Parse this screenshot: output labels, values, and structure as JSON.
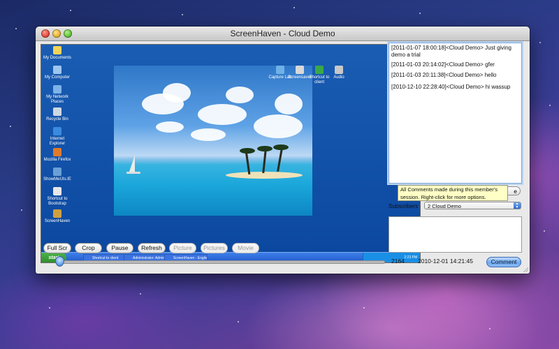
{
  "window": {
    "title": "ScreenHaven - Cloud Demo"
  },
  "remote_desktop": {
    "icons": [
      "My Documents",
      "My Computer",
      "My Network Places",
      "Recycle Bin",
      "Internet Explorer",
      "Mozilla Firefox",
      "ShowMeUIs.IE",
      "Shortcut to Bootstrap",
      "ScreenHaven"
    ],
    "top_icons": [
      "Capture Lab",
      "Screensaver",
      "Shortcut to client",
      "Audio"
    ],
    "start_label": "start",
    "taskbar_items": [
      "Shortcut to client",
      "Administrator: Admin...",
      "ScreenHaven - English"
    ],
    "tray_time": "2:23 PM"
  },
  "toolbar": {
    "full_scr": "Full Scr",
    "crop": "Crop",
    "pause": "Pause",
    "refresh": "Refresh",
    "picture": "Picture",
    "pictures": "Pictures",
    "movie": "Movie"
  },
  "playback": {
    "frame": "2164",
    "timestamp": "2010-12-01 14:21:45",
    "position": 0.0
  },
  "comments": [
    {
      "line1": "[2011-01-07 18:00:18]<Cloud Demo> Just giving",
      "line2": "demo a trial"
    },
    {
      "line1": "[2011-01-03 20:14:02]<Cloud Demo> gfer",
      "line2": ""
    },
    {
      "line1": "[2011-01-03 20:11:38]<Cloud Demo> hello",
      "line2": ""
    },
    {
      "line1": "[2010-12-10 22:28:40]<Cloud Demo> hi wassup",
      "line2": ""
    }
  ],
  "tooltip": {
    "line1": "All Comments made during this member's",
    "line2": "session. Right-click for more options."
  },
  "hidden_button_label": "e",
  "subscribers": {
    "label": "Subscribers",
    "selected": "2 Cloud Demo"
  },
  "compose": {
    "value": ""
  },
  "comment_button": "Comment",
  "colors": {
    "accent": "#6ea8ee",
    "desktop_blue": "#0c48a0",
    "tooltip_bg": "#ffffc6"
  }
}
